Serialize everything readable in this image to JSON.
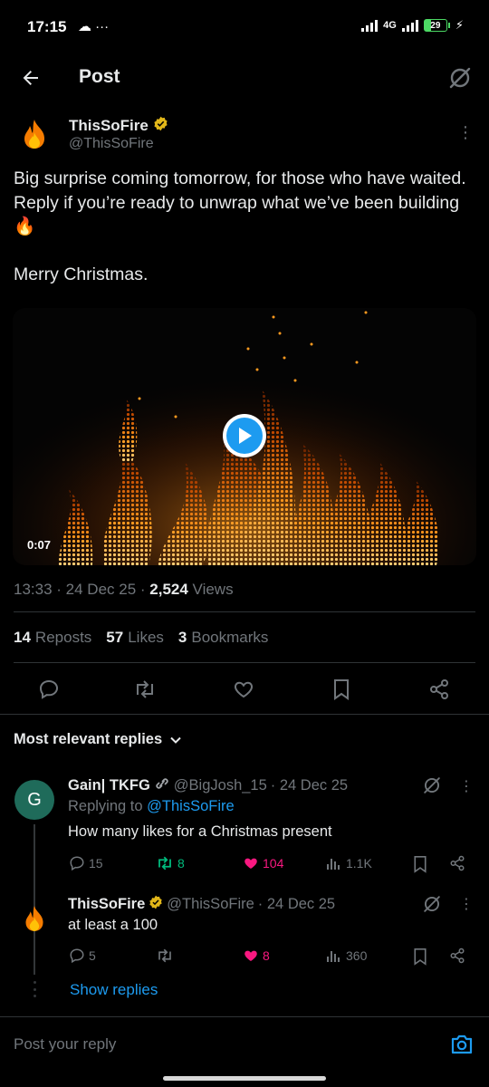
{
  "status_bar": {
    "time": "17:15",
    "left_icons": "☁ ···",
    "network": "4G",
    "battery": "29"
  },
  "header": {
    "title": "Post"
  },
  "post": {
    "author_name": "ThisSoFire",
    "author_handle": "@ThisSoFire",
    "text": "Big surprise coming tomorrow, for those who have waited. Reply if you’re ready to unwrap what we’ve been building 🔥\n\nMerry Christmas.",
    "video_duration": "0:07",
    "time": "13:33",
    "date": "24 Dec 25",
    "views_count": "2,524",
    "views_label": "Views",
    "reposts_count": "14",
    "reposts_label": "Reposts",
    "likes_count": "57",
    "likes_label": "Likes",
    "bookmarks_count": "3",
    "bookmarks_label": "Bookmarks"
  },
  "replies_sort": {
    "label": "Most relevant replies"
  },
  "replies": [
    {
      "avatar_letter": "G",
      "avatar_color": "#1f6b5a",
      "name": "Gain| TKFG",
      "handle": "@BigJosh_15",
      "date": "· 24 Dec 25",
      "replying_prefix": "Replying to",
      "replying_to": "@ThisSoFire",
      "text": "How many likes for a Christmas present",
      "comments": "15",
      "reposts": "8",
      "likes": "104",
      "views": "1.1K"
    },
    {
      "name": "ThisSoFire",
      "handle": "@ThisSoFire",
      "date": "· 24 Dec 25",
      "text": "at least a 100",
      "comments": "5",
      "reposts": "",
      "likes": "8",
      "views": "360"
    }
  ],
  "show_replies_label": "Show replies",
  "compose": {
    "placeholder": "Post your reply"
  },
  "colors": {
    "accent": "#1d9bf0",
    "like": "#f91880",
    "repost": "#00ba7c",
    "verified": "#e2b719",
    "muted": "#71767b"
  }
}
